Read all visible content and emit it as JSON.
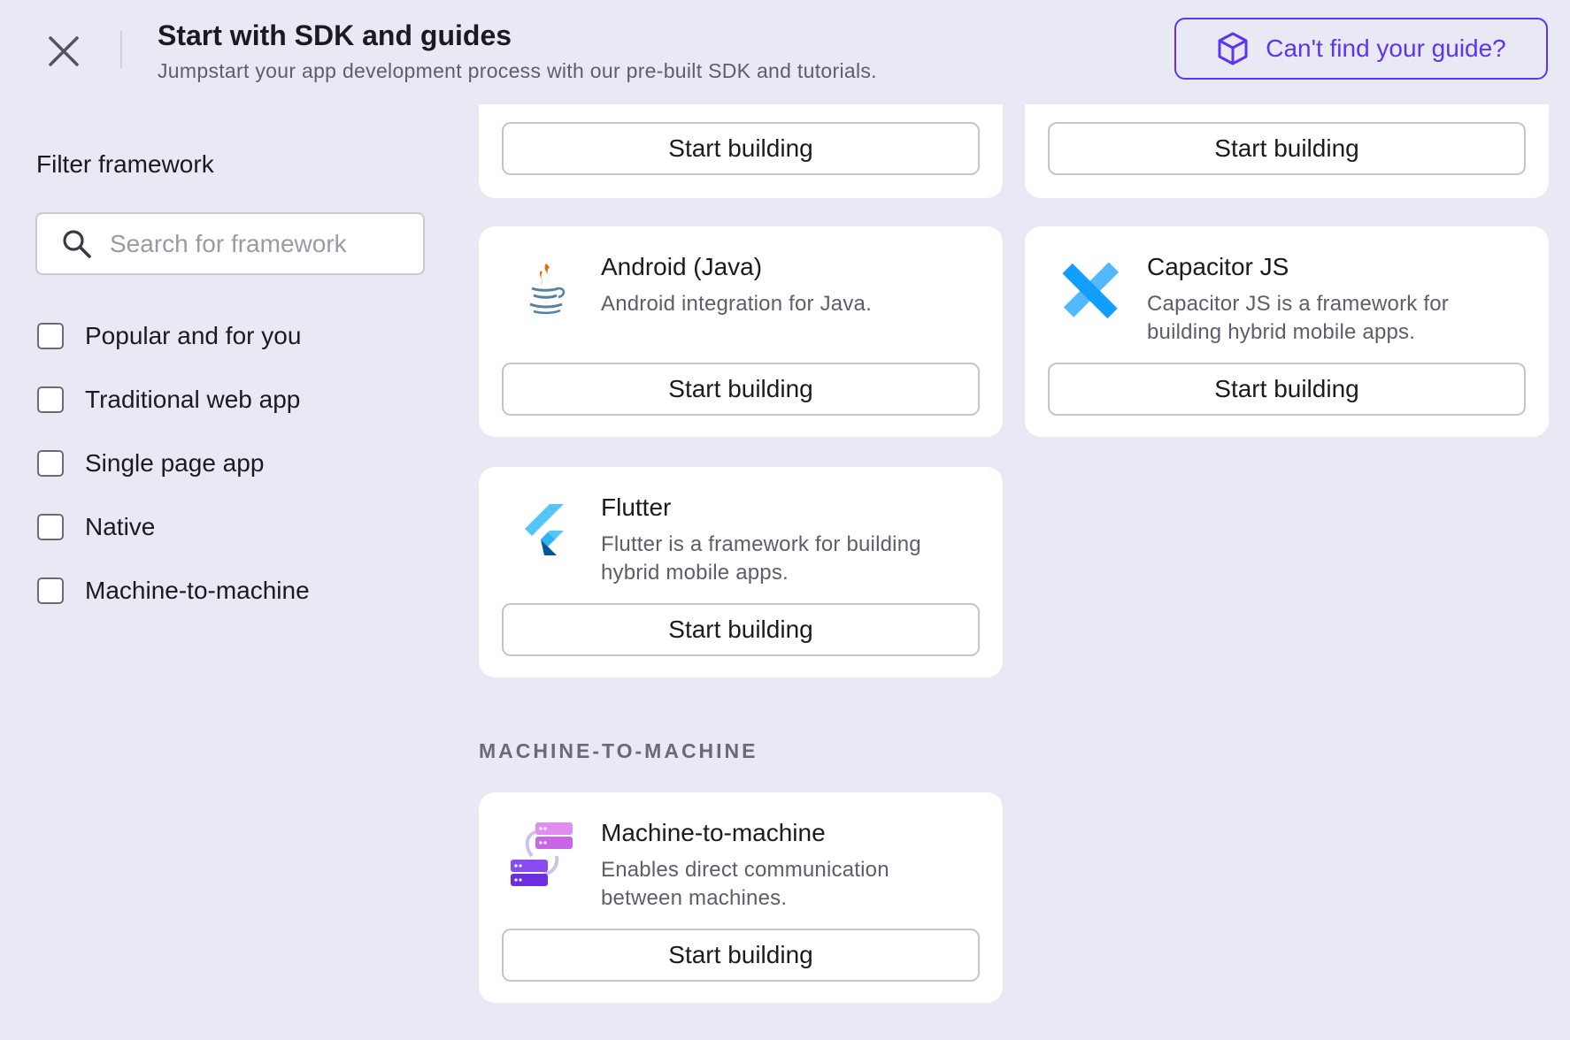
{
  "header": {
    "title": "Start with SDK and guides",
    "subtitle": "Jumpstart your app development process with our pre-built SDK and tutorials.",
    "guide_button": "Can't find your guide?"
  },
  "sidebar": {
    "filter_title": "Filter framework",
    "search_placeholder": "Search for framework",
    "filters": [
      {
        "label": "Popular and for you",
        "checked": false
      },
      {
        "label": "Traditional web app",
        "checked": false
      },
      {
        "label": "Single page app",
        "checked": false
      },
      {
        "label": "Native",
        "checked": false
      },
      {
        "label": "Machine-to-machine",
        "checked": false
      }
    ]
  },
  "cards": {
    "top_left": {
      "button": "Start building"
    },
    "top_right": {
      "button": "Start building"
    },
    "android": {
      "title": "Android (Java)",
      "description": "Android integration for Java.",
      "button": "Start building",
      "icon": "java-icon"
    },
    "capacitor": {
      "title": "Capacitor JS",
      "description": "Capacitor JS is a framework for building hybrid mobile apps.",
      "button": "Start building",
      "icon": "capacitor-icon"
    },
    "flutter": {
      "title": "Flutter",
      "description": "Flutter is a framework for building hybrid mobile apps.",
      "button": "Start building",
      "icon": "flutter-icon"
    },
    "m2m": {
      "title": "Machine-to-machine",
      "description": "Enables direct communication between machines.",
      "button": "Start building",
      "icon": "servers-icon"
    }
  },
  "sections": {
    "m2m_header": "MACHINE-TO-MACHINE"
  },
  "colors": {
    "background": "#e9e8f5",
    "accent": "#5d34f2",
    "card": "#ffffff"
  }
}
